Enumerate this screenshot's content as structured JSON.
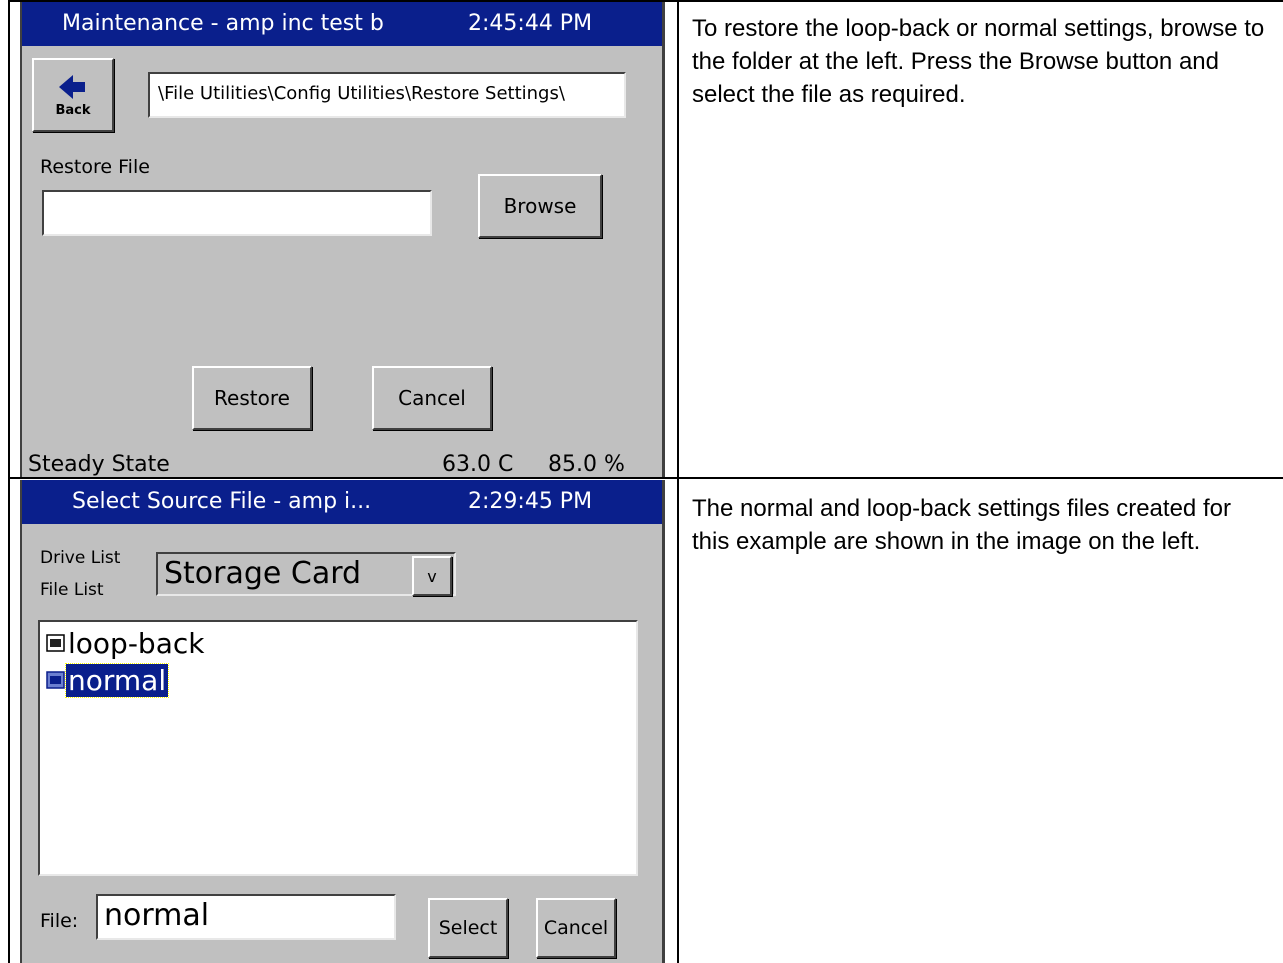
{
  "row1": {
    "device": {
      "title": "Maintenance - amp inc test b",
      "time": "2:45:44 PM",
      "back_label": "Back",
      "path": "\\File Utilities\\Config Utilities\\Restore Settings\\",
      "restore_file_label": "Restore File",
      "restore_file_value": "",
      "browse_label": "Browse",
      "restore_label": "Restore",
      "cancel_label": "Cancel",
      "status": "Steady State",
      "temperature": "63.0 C",
      "humidity": "85.0 %"
    },
    "description": "To restore the loop-back or normal settings, browse to the folder at the left.  Press the Browse button and select the file as required."
  },
  "row2": {
    "device": {
      "title": "Select Source File - amp i...",
      "time": "2:29:45 PM",
      "drive_list_label": "Drive List",
      "drive_value": "Storage Card",
      "dropdown_label": "v",
      "file_list_label": "File List",
      "files": [
        "loop-back",
        "normal"
      ],
      "selected_file": "normal",
      "file_label": "File:",
      "file_value": "normal",
      "select_label": "Select",
      "cancel_label": "Cancel"
    },
    "description": "The normal and loop-back settings files created for this example are shown in the image on the left."
  }
}
